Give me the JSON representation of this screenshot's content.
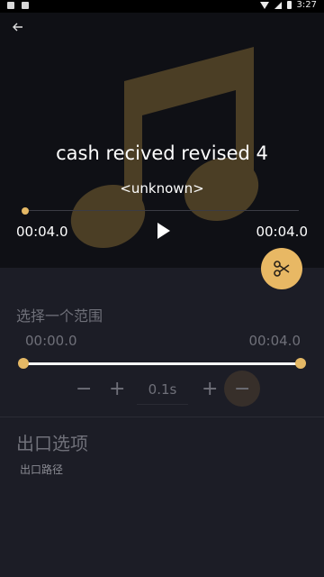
{
  "status_bar": {
    "time": "3:27"
  },
  "track": {
    "title": "cash recived revised 4",
    "artist": "<unknown>",
    "current_time": "00:04.0",
    "total_time": "00:04.0",
    "progress": 0
  },
  "range": {
    "section_title": "选择一个范围",
    "start": "00:00.0",
    "end": "00:04.0",
    "start_fraction": 0,
    "end_fraction": 1
  },
  "steppers": {
    "minus_left": "−",
    "plus_left": "+",
    "step_value": "0.1s",
    "plus_right": "+",
    "minus_right": "−"
  },
  "export": {
    "title": "出口选项",
    "path_label": "出口路径"
  },
  "colors": {
    "accent": "#e8b864",
    "background": "#1c1d26",
    "top_background": "#0f1015",
    "muted_text": "#6f7079"
  },
  "icons": {
    "back": "arrow-left-icon",
    "play": "play-icon",
    "cut": "scissors-icon",
    "music_art": "music-note-icon"
  }
}
